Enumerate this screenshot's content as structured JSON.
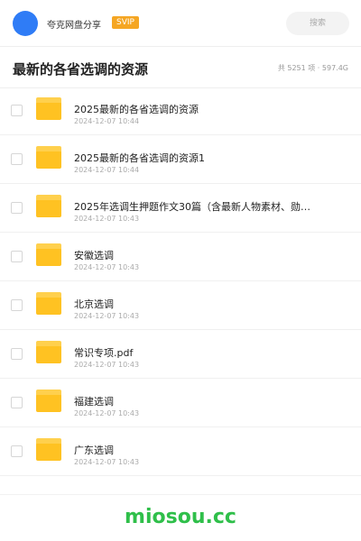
{
  "header": {
    "user_name": "夸克网盘分享",
    "badge": "SVIP",
    "search_placeholder": "搜索",
    "avatar_color": "#2f7cf6"
  },
  "title_bar": {
    "title": "最新的各省选调的资源",
    "stats": "共 5251 项 · 597.4G"
  },
  "files": [
    {
      "name": "2025最新的各省选调的资源",
      "date": "2024-12-07 10:44",
      "icon": "folder-icon"
    },
    {
      "name": "2025最新的各省选调的资源1",
      "date": "2024-12-07 10:44",
      "icon": "folder-icon"
    },
    {
      "name": "2025年选调生押题作文30篇（含最新人物素材、勋…",
      "date": "2024-12-07 10:43",
      "icon": "folder-icon"
    },
    {
      "name": "安徽选调",
      "date": "2024-12-07 10:43",
      "icon": "folder-icon"
    },
    {
      "name": "北京选调",
      "date": "2024-12-07 10:43",
      "icon": "folder-icon"
    },
    {
      "name": "常识专项.pdf",
      "date": "2024-12-07 10:43",
      "icon": "folder-icon"
    },
    {
      "name": "福建选调",
      "date": "2024-12-07 10:43",
      "icon": "folder-icon"
    },
    {
      "name": "广东选调",
      "date": "2024-12-07 10:43",
      "icon": "folder-icon"
    }
  ],
  "watermark": {
    "text": "miosou.cc",
    "color": "#2fbf4a"
  },
  "colors": {
    "accent": "#2f7cf6",
    "badge": "#f5a623",
    "folder": "#ffc222"
  }
}
